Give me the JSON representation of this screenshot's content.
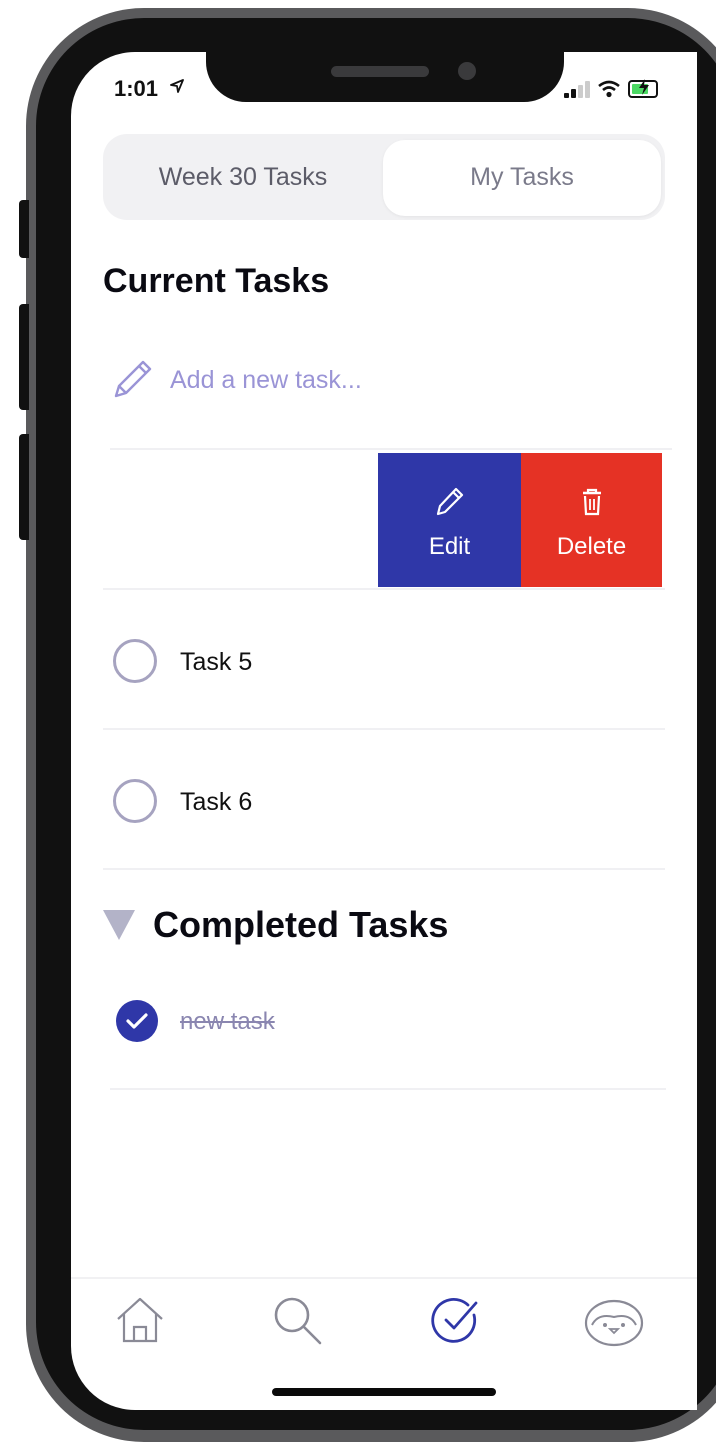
{
  "status": {
    "time": "1:01"
  },
  "segments": [
    {
      "label": "Week 30 Tasks",
      "selected": false
    },
    {
      "label": "My Tasks",
      "selected": true
    }
  ],
  "current_section": {
    "title": "Current Tasks",
    "add_placeholder": "Add a new task..."
  },
  "swipe_actions": {
    "edit_label": "Edit",
    "delete_label": "Delete"
  },
  "tasks": [
    {
      "label": "Task 5",
      "done": false
    },
    {
      "label": "Task 6",
      "done": false
    }
  ],
  "completed_section": {
    "title": "Completed Tasks",
    "items": [
      {
        "label": "new task",
        "done": true
      }
    ]
  },
  "tabbar": {
    "items": [
      {
        "icon": "home-icon",
        "active": false
      },
      {
        "icon": "search-icon",
        "active": false
      },
      {
        "icon": "check-circle-icon",
        "active": true
      },
      {
        "icon": "penguin-profile-icon",
        "active": false
      }
    ]
  },
  "colors": {
    "accent": "#2f37a8",
    "delete": "#e53225",
    "placeholder": "#9a94d6",
    "inactive_icon": "#8a8a96"
  }
}
